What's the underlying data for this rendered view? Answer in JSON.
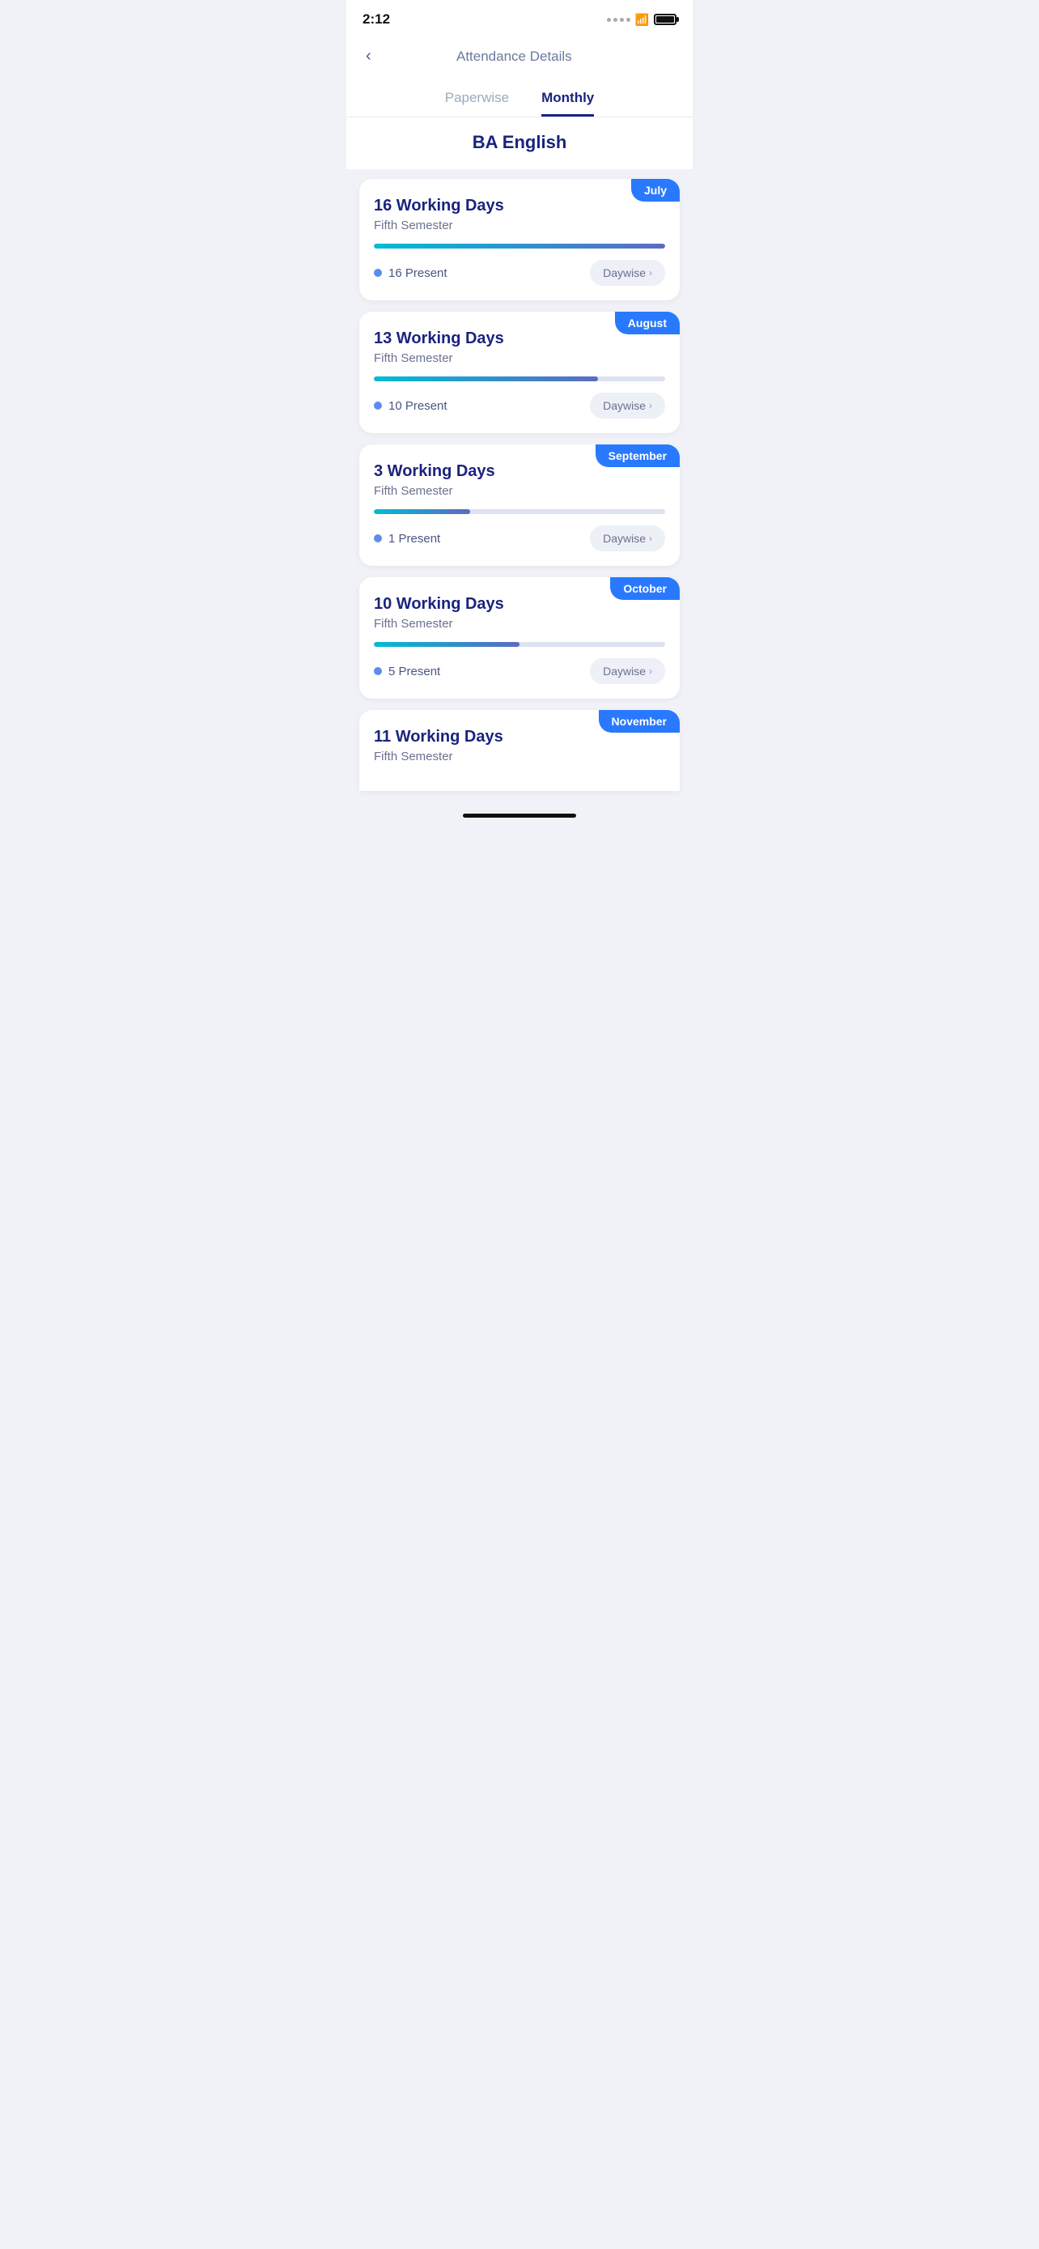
{
  "statusBar": {
    "time": "2:12"
  },
  "header": {
    "title": "Attendance Details",
    "backIcon": "‹"
  },
  "tabs": [
    {
      "id": "paperwise",
      "label": "Paperwise",
      "active": false
    },
    {
      "id": "monthly",
      "label": "Monthly",
      "active": true
    }
  ],
  "courseTitle": "BA English",
  "months": [
    {
      "badge": "July",
      "workingDays": "16 Working Days",
      "semester": "Fifth Semester",
      "presentCount": "16 Present",
      "progressPercent": 100,
      "daywiseLabel": "Daywise"
    },
    {
      "badge": "August",
      "workingDays": "13 Working Days",
      "semester": "Fifth Semester",
      "presentCount": "10 Present",
      "progressPercent": 77,
      "daywiseLabel": "Daywise"
    },
    {
      "badge": "September",
      "workingDays": "3 Working Days",
      "semester": "Fifth Semester",
      "presentCount": "1 Present",
      "progressPercent": 33,
      "daywiseLabel": "Daywise"
    },
    {
      "badge": "October",
      "workingDays": "10 Working Days",
      "semester": "Fifth Semester",
      "presentCount": "5 Present",
      "progressPercent": 50,
      "daywiseLabel": "Daywise"
    }
  ],
  "partialMonth": {
    "badge": "November",
    "workingDays": "11 Working Days",
    "semester": "Fifth Semester"
  }
}
